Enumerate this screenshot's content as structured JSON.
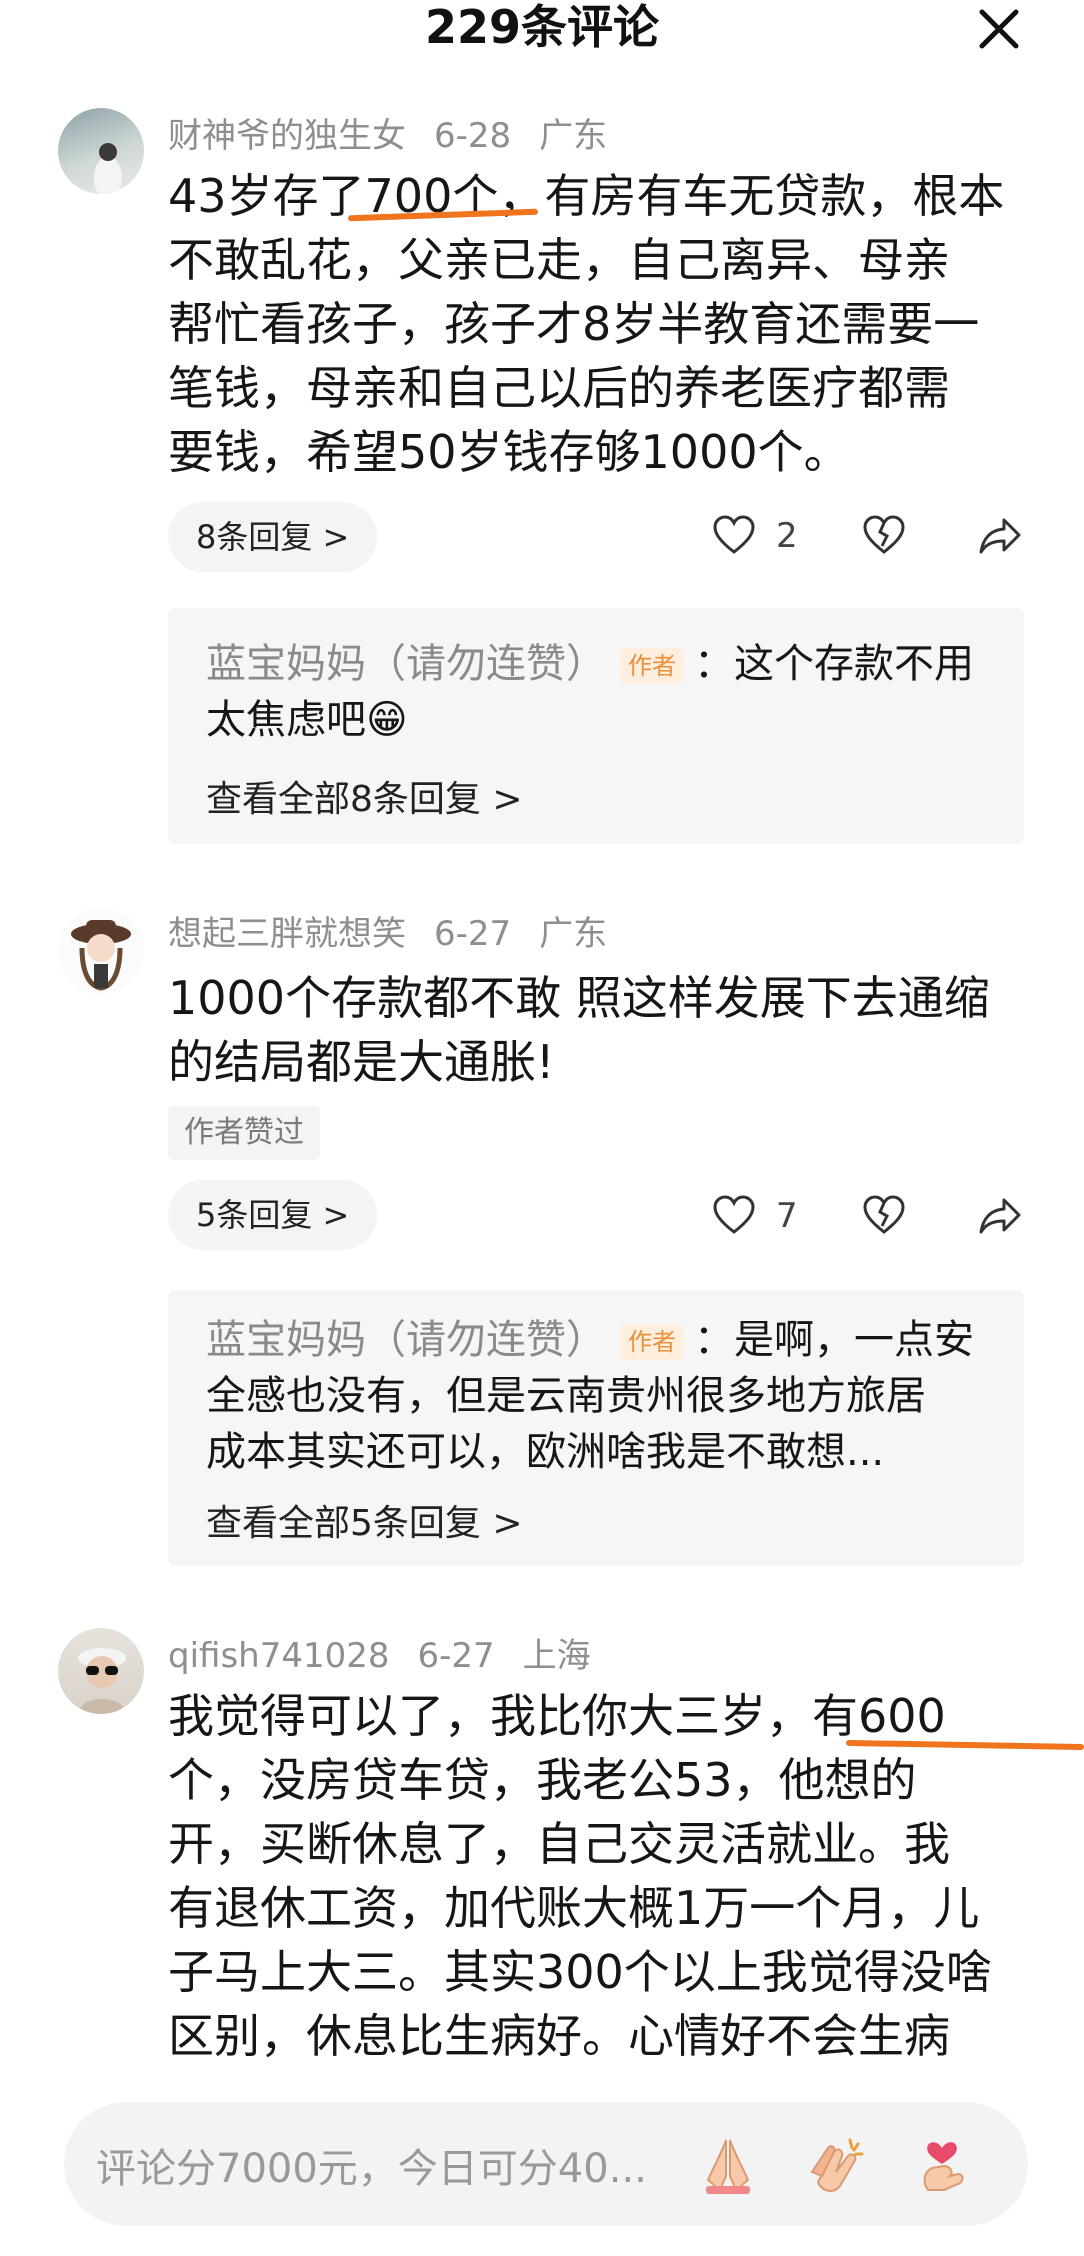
{
  "header": {
    "title": "229条评论"
  },
  "comments": [
    {
      "username": "财神爷的独生女",
      "date": "6-28",
      "location": "广东",
      "lines": [
        "43岁存了700个，有房有车无贷款，根本",
        "不敢乱花，父亲已走，自己离异、母亲",
        "帮忙看孩子，孩子才8岁半教育还需要一",
        "笔钱，母亲和自己以后的养老医疗都需",
        "要钱，希望50岁钱存够1000个。"
      ],
      "replies_label": "8条回复 >",
      "like_count": "2",
      "reply": {
        "author": "蓝宝妈妈（请勿连赞）",
        "author_tag": "作者",
        "line1": "：这个存款不用",
        "line2": "太焦虑吧😁",
        "view_all": "查看全部8条回复 >"
      }
    },
    {
      "username": "想起三胖就想笑",
      "date": "6-27",
      "location": "广东",
      "lines": [
        "1000个存款都不敢 照这样发展下去通缩",
        "的结局都是大通胀!"
      ],
      "liked_badge": "作者赞过",
      "replies_label": "5条回复 >",
      "like_count": "7",
      "reply": {
        "author": "蓝宝妈妈（请勿连赞）",
        "author_tag": "作者",
        "line1": "：是啊，一点安",
        "line2": "全感也没有，但是云南贵州很多地方旅居",
        "line3": "成本其实还可以，欧洲啥我是不敢想...",
        "view_all": "查看全部5条回复 >"
      }
    },
    {
      "username": "qifish741028",
      "date": "6-27",
      "location": "上海",
      "lines": [
        "我觉得可以了，我比你大三岁，有600",
        "个，没房贷车贷，我老公53，他想的",
        "开，买断休息了，自己交灵活就业。我",
        "有退休工资，加代账大概1万一个月，儿",
        "子马上大三。其实300个以上我觉得没啥",
        "区别，休息比生病好。心情好不会生病"
      ]
    }
  ],
  "bottom_bar": {
    "placeholder": "评论分7000元，今日可分40..."
  },
  "colors": {
    "highlight": "#f0731e",
    "author_tag_bg": "#fdeedd",
    "author_tag_text": "#e8903a"
  },
  "icons": [
    "close-icon",
    "heart-icon",
    "broken-heart-icon",
    "share-icon",
    "praying-hands-icon",
    "clapping-hands-icon",
    "finger-heart-icon"
  ]
}
